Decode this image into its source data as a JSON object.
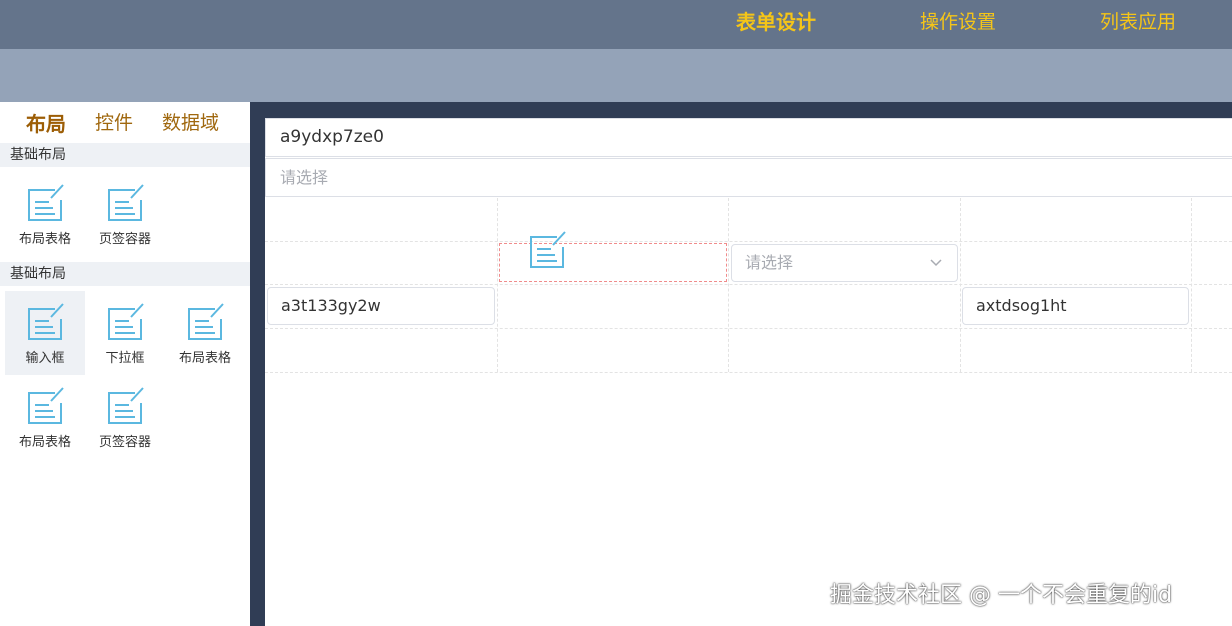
{
  "top_nav": {
    "items": [
      {
        "label": "表单设计",
        "active": true
      },
      {
        "label": "操作设置",
        "active": false
      },
      {
        "label": "列表应用",
        "active": false
      }
    ]
  },
  "sidebar": {
    "tabs": [
      {
        "label": "布局",
        "active": true
      },
      {
        "label": "控件",
        "active": false
      },
      {
        "label": "数据域",
        "active": false
      }
    ],
    "groups": [
      {
        "title": "基础布局",
        "items": [
          {
            "label": "布局表格",
            "icon": "form-edit-icon"
          },
          {
            "label": "页签容器",
            "icon": "form-edit-icon"
          }
        ]
      },
      {
        "title": "基础布局",
        "items": [
          {
            "label": "输入框",
            "icon": "form-edit-icon",
            "hovered": true
          },
          {
            "label": "下拉框",
            "icon": "form-edit-icon"
          },
          {
            "label": "布局表格",
            "icon": "form-edit-icon"
          },
          {
            "label": "布局表格",
            "icon": "form-edit-icon"
          },
          {
            "label": "页签容器",
            "icon": "form-edit-icon"
          }
        ]
      }
    ]
  },
  "canvas": {
    "title_value": "a9ydxp7ze0",
    "top_select_placeholder": "请选择",
    "grid_select_placeholder": "请选择",
    "input_1_value": "a3t133gy2w",
    "input_2_value": "axtdsog1ht"
  },
  "watermark": "掘金技术社区 @ 一个不会重复的id",
  "colors": {
    "topbar": "#64748b",
    "subbar": "#94a3b8",
    "nav_text": "#f5c518",
    "workspace": "#303d55",
    "drop_border": "#f08c8c",
    "icon_stroke": "#5bb8e0"
  }
}
